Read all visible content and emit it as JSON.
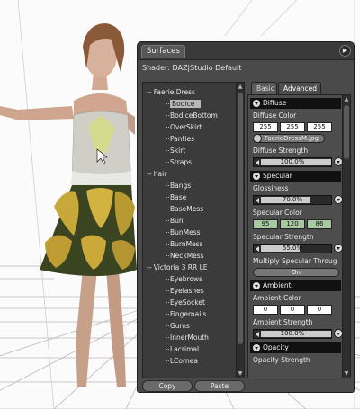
{
  "pane": {
    "title": "Surfaces",
    "shader_label": "Shader:",
    "shader_value": "DAZ|Studio Default"
  },
  "tree": [
    {
      "label": "Faerie Dress",
      "type": "group",
      "selected": false
    },
    {
      "label": "Bodice",
      "type": "child",
      "selected": true
    },
    {
      "label": "BodiceBottom",
      "type": "child",
      "selected": false
    },
    {
      "label": "OverSkirt",
      "type": "child",
      "selected": false
    },
    {
      "label": "Panties",
      "type": "child",
      "selected": false
    },
    {
      "label": "Skirt",
      "type": "child",
      "selected": false
    },
    {
      "label": "Straps",
      "type": "child",
      "selected": false
    },
    {
      "label": "hair",
      "type": "group",
      "selected": false
    },
    {
      "label": "Bangs",
      "type": "child",
      "selected": false
    },
    {
      "label": "Base",
      "type": "child",
      "selected": false
    },
    {
      "label": "BaseMess",
      "type": "child",
      "selected": false
    },
    {
      "label": "Bun",
      "type": "child",
      "selected": false
    },
    {
      "label": "BunMess",
      "type": "child",
      "selected": false
    },
    {
      "label": "BurnMess",
      "type": "child",
      "selected": false
    },
    {
      "label": "NeckMess",
      "type": "child",
      "selected": false
    },
    {
      "label": "Victoria 3 RR LE",
      "type": "group",
      "selected": false
    },
    {
      "label": "Eyebrows",
      "type": "child",
      "selected": false
    },
    {
      "label": "Eyelashes",
      "type": "child",
      "selected": false
    },
    {
      "label": "EyeSocket",
      "type": "child",
      "selected": false
    },
    {
      "label": "Fingernails",
      "type": "child",
      "selected": false
    },
    {
      "label": "Gums",
      "type": "child",
      "selected": false
    },
    {
      "label": "InnerMouth",
      "type": "child",
      "selected": false
    },
    {
      "label": "Lacrimal",
      "type": "child",
      "selected": false
    },
    {
      "label": "LCornea",
      "type": "child",
      "selected": false
    }
  ],
  "buttons": {
    "copy": "Copy",
    "paste": "Paste"
  },
  "tabs": {
    "basic": "Basic",
    "advanced": "Advanced"
  },
  "props": {
    "diffuse": {
      "section": "Diffuse",
      "color_label": "Diffuse Color",
      "color_rgb": [
        "255",
        "255",
        "255"
      ],
      "texture_map": "FaerieDressM.jpg",
      "strength_label": "Diffuse Strength",
      "strength_value": "100.0%",
      "strength_fraction": 1.0
    },
    "specular": {
      "section": "Specular",
      "glossiness_label": "Glossiness",
      "glossiness_value": "70.0%",
      "glossiness_fraction": 0.7,
      "color_label": "Specular Color",
      "color_rgb": [
        "95",
        "120",
        "86"
      ],
      "strength_label": "Specular Strength",
      "strength_value": "55.0%",
      "strength_fraction": 0.55,
      "multiply_label": "Multiply Specular Throug",
      "multiply_value": "On"
    },
    "ambient": {
      "section": "Ambient",
      "color_label": "Ambient Color",
      "color_rgb": [
        "0",
        "0",
        "0"
      ],
      "strength_label": "Ambient Strength",
      "strength_value": "100.0%",
      "strength_fraction": 1.0
    },
    "opacity": {
      "section": "Opacity",
      "strength_label": "Opacity Strength"
    }
  },
  "colors": {
    "panel_bg": "#4a4a4a",
    "section_bg": "#111111",
    "specular_color": "#5f7856",
    "selection": "#b8b8b8"
  },
  "icons": {
    "pane_menu": "pane-menu-icon",
    "section_toggle": "collapse-arrow-icon",
    "map_button": "texture-map-icon"
  }
}
